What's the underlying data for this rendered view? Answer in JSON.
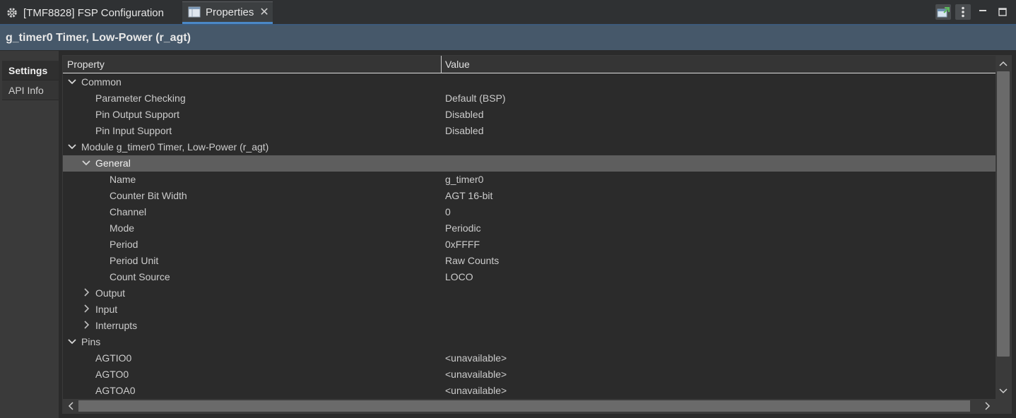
{
  "tabs": {
    "config_tab": "[TMF8828] FSP Configuration",
    "properties_tab": "Properties"
  },
  "banner": {
    "title": "g_timer0 Timer, Low-Power (r_agt)"
  },
  "side_tabs": {
    "settings": "Settings",
    "api_info": "API Info"
  },
  "table": {
    "col_property": "Property",
    "col_value": "Value",
    "rows": [
      {
        "level": 0,
        "chevron": "down",
        "property": "Common",
        "value": ""
      },
      {
        "level": 1,
        "chevron": "",
        "property": "Parameter Checking",
        "value": "Default (BSP)"
      },
      {
        "level": 1,
        "chevron": "",
        "property": "Pin Output Support",
        "value": "Disabled"
      },
      {
        "level": 1,
        "chevron": "",
        "property": "Pin Input Support",
        "value": "Disabled"
      },
      {
        "level": 0,
        "chevron": "down",
        "property": "Module g_timer0 Timer, Low-Power (r_agt)",
        "value": ""
      },
      {
        "level": 1,
        "chevron": "down",
        "property": "General",
        "value": "",
        "highlighted": true
      },
      {
        "level": 2,
        "chevron": "",
        "property": "Name",
        "value": "g_timer0"
      },
      {
        "level": 2,
        "chevron": "",
        "property": "Counter Bit Width",
        "value": "AGT 16-bit"
      },
      {
        "level": 2,
        "chevron": "",
        "property": "Channel",
        "value": "0"
      },
      {
        "level": 2,
        "chevron": "",
        "property": "Mode",
        "value": "Periodic"
      },
      {
        "level": 2,
        "chevron": "",
        "property": "Period",
        "value": "0xFFFF"
      },
      {
        "level": 2,
        "chevron": "",
        "property": "Period Unit",
        "value": "Raw Counts"
      },
      {
        "level": 2,
        "chevron": "",
        "property": "Count Source",
        "value": "LOCO"
      },
      {
        "level": 1,
        "chevron": "right",
        "property": "Output",
        "value": ""
      },
      {
        "level": 1,
        "chevron": "right",
        "property": "Input",
        "value": ""
      },
      {
        "level": 1,
        "chevron": "right",
        "property": "Interrupts",
        "value": ""
      },
      {
        "level": 0,
        "chevron": "down",
        "property": "Pins",
        "value": ""
      },
      {
        "level": 1,
        "chevron": "",
        "property": "AGTIO0",
        "value": "<unavailable>"
      },
      {
        "level": 1,
        "chevron": "",
        "property": "AGTO0",
        "value": "<unavailable>"
      },
      {
        "level": 1,
        "chevron": "",
        "property": "AGTOA0",
        "value": "<unavailable>"
      }
    ]
  },
  "colors": {
    "accent": "#4a88c7",
    "banner": "#46586a",
    "row_highlight": "#5e5e5e"
  },
  "icons": {
    "config_tab": "gear-icon",
    "properties_tab": "properties-icon",
    "toolbar": [
      "new-window-icon",
      "view-menu-icon",
      "minimize-icon",
      "maximize-icon"
    ]
  }
}
